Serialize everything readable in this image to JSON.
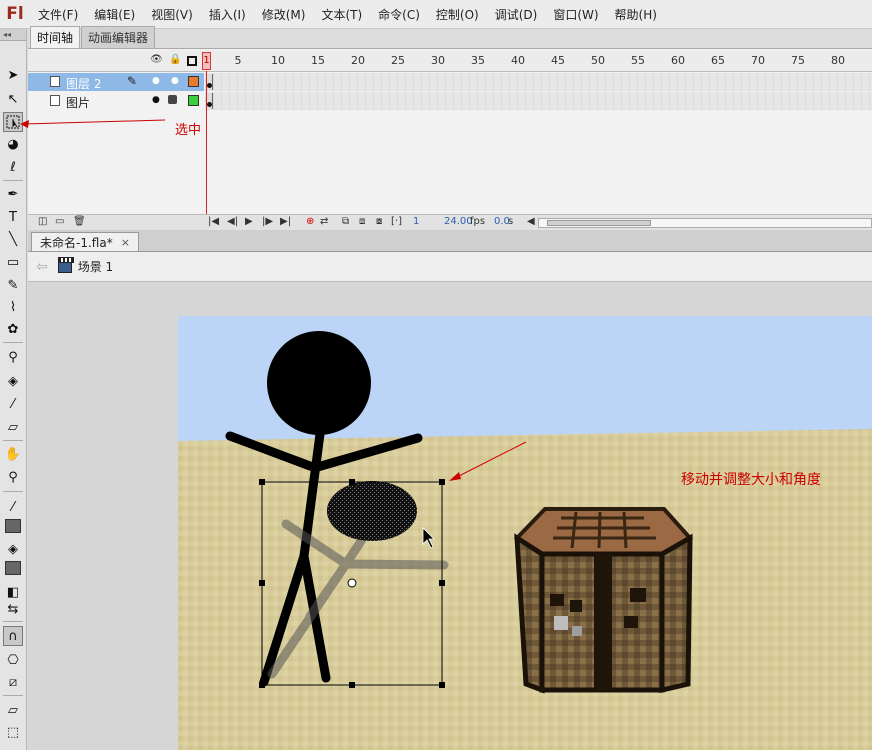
{
  "app": {
    "logo": "Fl"
  },
  "menu": [
    "文件(F)",
    "编辑(E)",
    "视图(V)",
    "插入(I)",
    "修改(M)",
    "文本(T)",
    "命令(C)",
    "控制(O)",
    "调试(D)",
    "窗口(W)",
    "帮助(H)"
  ],
  "toolbar": {
    "collapse": "◂◂",
    "text_tool": "T"
  },
  "timeline": {
    "tabs": [
      "时间轴",
      "动画编辑器"
    ],
    "frame_numbers": [
      "1",
      "5",
      "10",
      "15",
      "20",
      "25",
      "30",
      "35",
      "40",
      "45",
      "50",
      "55",
      "60",
      "65",
      "70",
      "75",
      "80"
    ],
    "layers": [
      {
        "name": "图层 2",
        "color": "#e87a2a",
        "active": true
      },
      {
        "name": "图片",
        "color": "#3ccf3c",
        "active": false
      }
    ],
    "current_frame": "1",
    "fps": "24.00",
    "fps_unit": "fps",
    "time": "0.0",
    "time_unit": "s"
  },
  "annotations": {
    "select": "选中",
    "move": "移动并调整大小和角度"
  },
  "document": {
    "tab": "未命名-1.fla*",
    "close": "×",
    "scene": "场景 1"
  },
  "colors": {
    "annotation": "#cc0000",
    "sky": "#bcd5f7",
    "sand": "#d8cc9a",
    "active_layer": "#8eb8e6"
  }
}
